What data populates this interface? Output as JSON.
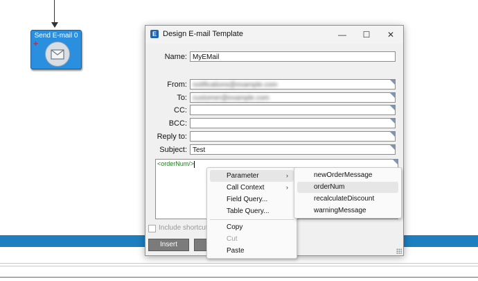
{
  "canvas": {
    "node": {
      "title": "Send E-mail 0",
      "plus_symbol": "+",
      "icon": "envelope-icon"
    }
  },
  "dialog": {
    "title": "Design E-mail Template",
    "app_icon_letter": "E",
    "window_controls": {
      "minimize": "—",
      "maximize": "☐",
      "close": "✕"
    },
    "fields": {
      "name": {
        "label": "Name:",
        "value": "MyEMail"
      },
      "from": {
        "label": "From:",
        "value": "notifications@example.com",
        "blurred": true
      },
      "to": {
        "label": "To:",
        "value": "customer@example.com",
        "blurred": true
      },
      "cc": {
        "label": "CC:",
        "value": ""
      },
      "bcc": {
        "label": "BCC:",
        "value": ""
      },
      "reply_to": {
        "label": "Reply to:",
        "value": ""
      },
      "subject": {
        "label": "Subject:",
        "value": "Test"
      }
    },
    "body_text": "<orderNum/>",
    "include_shortcut_label": "Include shortcut li",
    "insert_button": "Insert"
  },
  "context_menu": {
    "items": [
      {
        "label": "Parameter",
        "has_submenu": true,
        "highlighted": true
      },
      {
        "label": "Call Context",
        "has_submenu": true
      },
      {
        "label": "Field Query..."
      },
      {
        "label": "Table Query..."
      },
      {
        "label": "Copy"
      },
      {
        "label": "Cut",
        "disabled": true
      },
      {
        "label": "Paste"
      }
    ],
    "submenu_arrow": "›"
  },
  "submenu": {
    "items": [
      {
        "label": "newOrderMessage"
      },
      {
        "label": "orderNum",
        "highlighted": true
      },
      {
        "label": "recalculateDiscount"
      },
      {
        "label": "warningMessage"
      }
    ]
  }
}
